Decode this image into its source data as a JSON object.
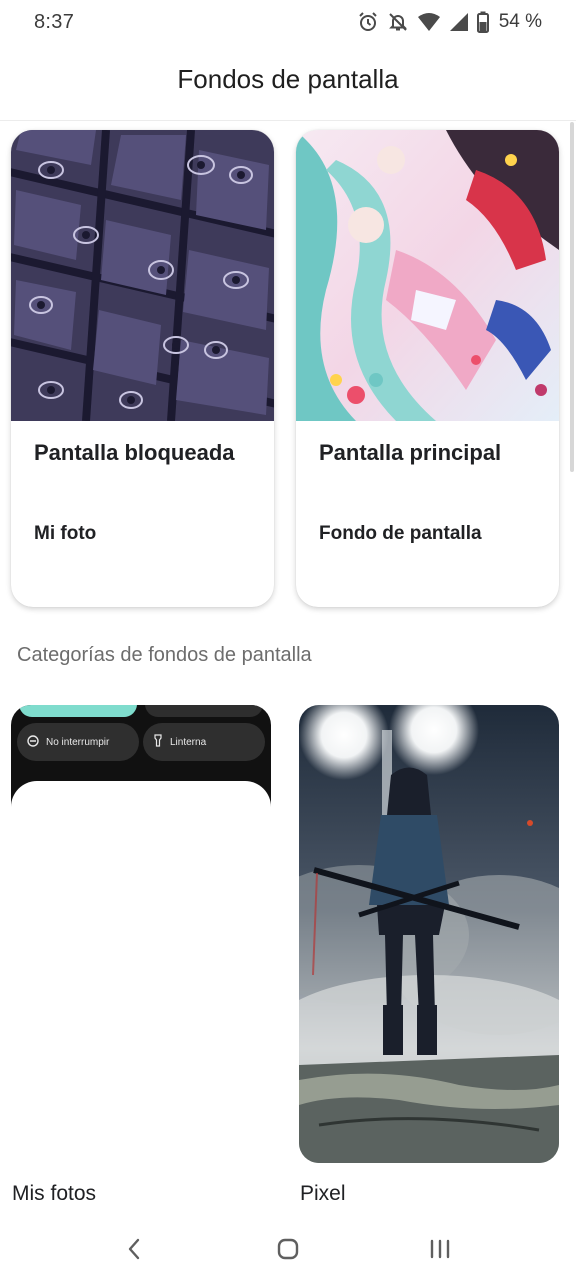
{
  "status_bar": {
    "time": "8:37",
    "battery": "54 %",
    "icons": [
      "alarm-icon",
      "notifications-off-icon",
      "wifi-icon",
      "signal-icon",
      "battery-icon"
    ]
  },
  "header": {
    "title": "Fondos de pantalla"
  },
  "current_wallpapers": [
    {
      "title": "Pantalla bloqueada",
      "subtitle": "Mi foto"
    },
    {
      "title": "Pantalla principal",
      "subtitle": "Fondo de pantalla"
    }
  ],
  "categories_section": {
    "heading": "Categorías de fondos de pantalla",
    "items": [
      {
        "label": "Mis fotos",
        "preview_chips": [
          "No interrumpir",
          "Linterna"
        ]
      },
      {
        "label": "Pixel"
      }
    ]
  },
  "nav_bar": {
    "buttons": [
      "back-icon",
      "home-icon",
      "recents-icon"
    ]
  },
  "colors": {
    "manga_bg": "#3e3a5a",
    "accent_teal": "#7fdccd",
    "qs_dark": "#111111"
  }
}
